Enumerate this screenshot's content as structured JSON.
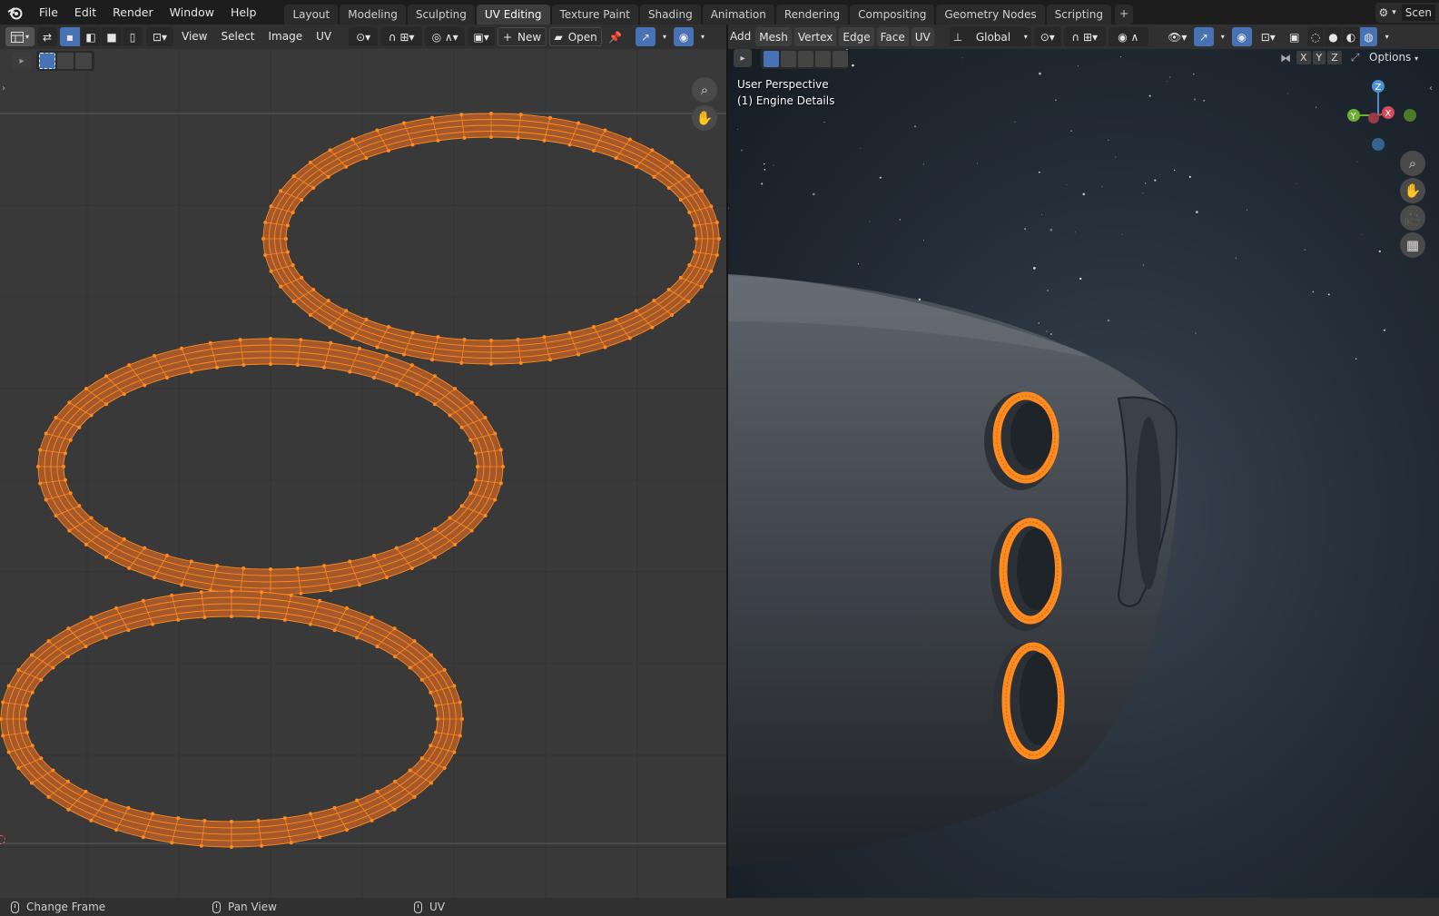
{
  "menu": [
    "File",
    "Edit",
    "Render",
    "Window",
    "Help"
  ],
  "workspaces": [
    "Layout",
    "Modeling",
    "Sculpting",
    "UV Editing",
    "Texture Paint",
    "Shading",
    "Animation",
    "Rendering",
    "Compositing",
    "Geometry Nodes",
    "Scripting"
  ],
  "active_workspace": "UV Editing",
  "scene_label": "Scen",
  "uv_header": {
    "view": "View",
    "select": "Select",
    "image": "Image",
    "uv": "UV",
    "new": "New",
    "open": "Open"
  },
  "v3_header": {
    "add": "Add",
    "mesh": "Mesh",
    "vertex": "Vertex",
    "edge": "Edge",
    "face": "Face",
    "uv": "UV",
    "orientation": "Global",
    "options": "Options"
  },
  "viewport": {
    "perspective": "User Perspective",
    "object": "(1) Engine Details",
    "axes": [
      "X",
      "Y",
      "Z"
    ]
  },
  "gizmo": {
    "z": "Z",
    "y": "Y",
    "x": "X"
  },
  "status": [
    {
      "label": "Change Frame"
    },
    {
      "label": "Pan View"
    },
    {
      "label": "UV"
    }
  ],
  "colors": {
    "uv_fill": "#a5582a",
    "uv_edge": "#ff8a1d",
    "select_blue": "#4772b3"
  }
}
